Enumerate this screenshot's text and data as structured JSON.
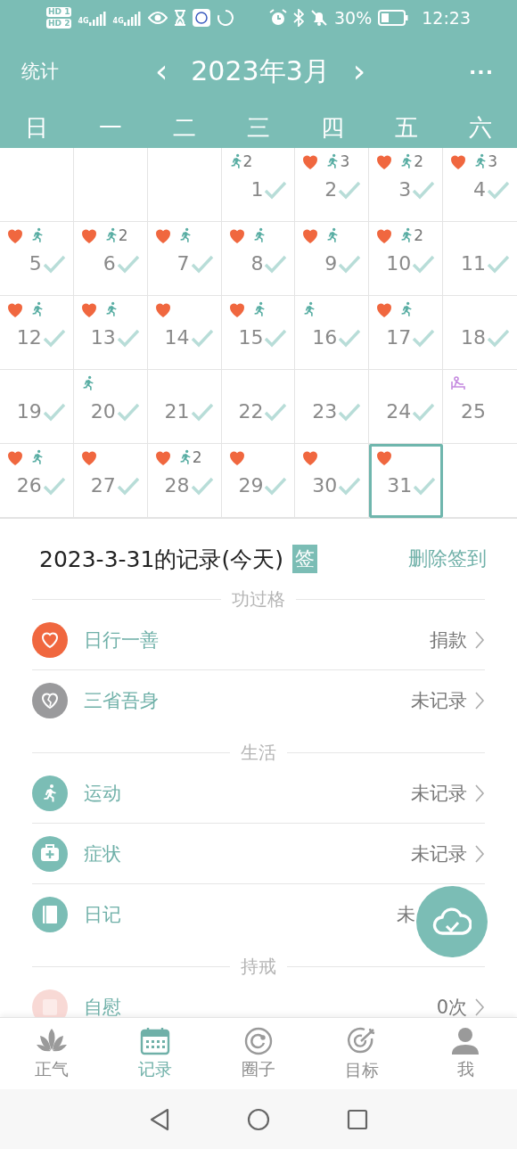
{
  "status_bar": {
    "sims": [
      {
        "label": "HD",
        "slot": "1"
      },
      {
        "label": "HD",
        "slot": "2"
      }
    ],
    "networks": [
      "4G",
      "4G"
    ],
    "battery": "30%",
    "time": "12:23"
  },
  "header": {
    "left": "统计",
    "prev": "‹",
    "month": "2023年3月",
    "next": "›",
    "more": "···"
  },
  "weekdays": [
    "日",
    "一",
    "二",
    "三",
    "四",
    "五",
    "六"
  ],
  "calendar": {
    "cells": [
      {
        "kind": "blank"
      },
      {
        "kind": "blank"
      },
      {
        "kind": "blank"
      },
      {
        "kind": "day",
        "day": "1",
        "icons": [
          {
            "kind": "run",
            "count": "2"
          }
        ],
        "checked": true,
        "selected": false
      },
      {
        "kind": "day",
        "day": "2",
        "icons": [
          {
            "kind": "heart"
          },
          {
            "kind": "run",
            "count": "3"
          }
        ],
        "checked": true,
        "selected": false
      },
      {
        "kind": "day",
        "day": "3",
        "icons": [
          {
            "kind": "heart"
          },
          {
            "kind": "run",
            "count": "2"
          }
        ],
        "checked": true,
        "selected": false
      },
      {
        "kind": "day",
        "day": "4",
        "icons": [
          {
            "kind": "heart"
          },
          {
            "kind": "run",
            "count": "3"
          }
        ],
        "checked": true,
        "selected": false
      },
      {
        "kind": "day",
        "day": "5",
        "icons": [
          {
            "kind": "heart"
          },
          {
            "kind": "run"
          }
        ],
        "checked": true,
        "selected": false
      },
      {
        "kind": "day",
        "day": "6",
        "icons": [
          {
            "kind": "heart"
          },
          {
            "kind": "run",
            "count": "2"
          }
        ],
        "checked": true,
        "selected": false
      },
      {
        "kind": "day",
        "day": "7",
        "icons": [
          {
            "kind": "heart"
          },
          {
            "kind": "run"
          }
        ],
        "checked": true,
        "selected": false
      },
      {
        "kind": "day",
        "day": "8",
        "icons": [
          {
            "kind": "heart"
          },
          {
            "kind": "run"
          }
        ],
        "checked": true,
        "selected": false
      },
      {
        "kind": "day",
        "day": "9",
        "icons": [
          {
            "kind": "heart"
          },
          {
            "kind": "run"
          }
        ],
        "checked": true,
        "selected": false
      },
      {
        "kind": "day",
        "day": "10",
        "icons": [
          {
            "kind": "heart"
          },
          {
            "kind": "run",
            "count": "2"
          }
        ],
        "checked": true,
        "selected": false
      },
      {
        "kind": "day",
        "day": "11",
        "checked": true,
        "selected": false
      },
      {
        "kind": "day",
        "day": "12",
        "icons": [
          {
            "kind": "heart"
          },
          {
            "kind": "run"
          }
        ],
        "checked": true,
        "selected": false
      },
      {
        "kind": "day",
        "day": "13",
        "icons": [
          {
            "kind": "heart"
          },
          {
            "kind": "run"
          }
        ],
        "checked": true,
        "selected": false
      },
      {
        "kind": "day",
        "day": "14",
        "icons": [
          {
            "kind": "heart"
          }
        ],
        "checked": true,
        "selected": false
      },
      {
        "kind": "day",
        "day": "15",
        "icons": [
          {
            "kind": "heart"
          },
          {
            "kind": "run"
          }
        ],
        "checked": true,
        "selected": false
      },
      {
        "kind": "day",
        "day": "16",
        "icons": [
          {
            "kind": "run"
          }
        ],
        "checked": true,
        "selected": false
      },
      {
        "kind": "day",
        "day": "17",
        "icons": [
          {
            "kind": "heart"
          },
          {
            "kind": "run"
          }
        ],
        "checked": true,
        "selected": false
      },
      {
        "kind": "day",
        "day": "18",
        "checked": true,
        "selected": false
      },
      {
        "kind": "day",
        "day": "19",
        "checked": true,
        "selected": false
      },
      {
        "kind": "day",
        "day": "20",
        "icons": [
          {
            "kind": "run"
          }
        ],
        "checked": true,
        "selected": false
      },
      {
        "kind": "day",
        "day": "21",
        "checked": true,
        "selected": false
      },
      {
        "kind": "day",
        "day": "22",
        "checked": true,
        "selected": false
      },
      {
        "kind": "day",
        "day": "23",
        "checked": true,
        "selected": false
      },
      {
        "kind": "day",
        "day": "24",
        "checked": true,
        "selected": false
      },
      {
        "kind": "day",
        "day": "25",
        "icons": [
          {
            "kind": "meditate"
          }
        ],
        "checked": false,
        "selected": false
      },
      {
        "kind": "day",
        "day": "26",
        "icons": [
          {
            "kind": "heart"
          },
          {
            "kind": "run"
          }
        ],
        "checked": true,
        "selected": false
      },
      {
        "kind": "day",
        "day": "27",
        "icons": [
          {
            "kind": "heart"
          }
        ],
        "checked": true,
        "selected": false
      },
      {
        "kind": "day",
        "day": "28",
        "icons": [
          {
            "kind": "heart"
          },
          {
            "kind": "run",
            "count": "2"
          }
        ],
        "checked": true,
        "selected": false
      },
      {
        "kind": "day",
        "day": "29",
        "icons": [
          {
            "kind": "heart"
          }
        ],
        "checked": true,
        "selected": false
      },
      {
        "kind": "day",
        "day": "30",
        "icons": [
          {
            "kind": "heart"
          }
        ],
        "checked": true,
        "selected": false
      },
      {
        "kind": "day",
        "day": "31",
        "icons": [
          {
            "kind": "heart"
          }
        ],
        "checked": true,
        "selected": true
      },
      {
        "kind": "blank"
      }
    ]
  },
  "record": {
    "title": "2023-3-31的记录(今天)",
    "badge": "签",
    "action": "删除签到",
    "sections": [
      {
        "title": "功过格",
        "items": [
          {
            "kind": "heart",
            "label": "日行一善",
            "value": "捐款",
            "chevron": true
          },
          {
            "kind": "broken-heart",
            "label": "三省吾身",
            "value": "未记录",
            "chevron": true
          }
        ]
      },
      {
        "title": "生活",
        "items": [
          {
            "kind": "run",
            "label": "运动",
            "value": "未记录",
            "chevron": true
          },
          {
            "kind": "medkit",
            "label": "症状",
            "value": "未记录",
            "chevron": true
          },
          {
            "kind": "book",
            "label": "日记",
            "value": "未",
            "chevron": false
          }
        ]
      },
      {
        "title": "持戒",
        "items": [
          {
            "kind": "roll",
            "label": "自慰",
            "value": "0次",
            "chevron": true
          }
        ]
      }
    ]
  },
  "nav": [
    {
      "kind": "lotus",
      "label": "正气",
      "selected": false
    },
    {
      "kind": "calendar",
      "label": "记录",
      "selected": true
    },
    {
      "kind": "ring",
      "label": "圈子",
      "selected": false
    },
    {
      "kind": "target",
      "label": "目标",
      "selected": false
    },
    {
      "kind": "person",
      "label": "我",
      "selected": false
    }
  ]
}
